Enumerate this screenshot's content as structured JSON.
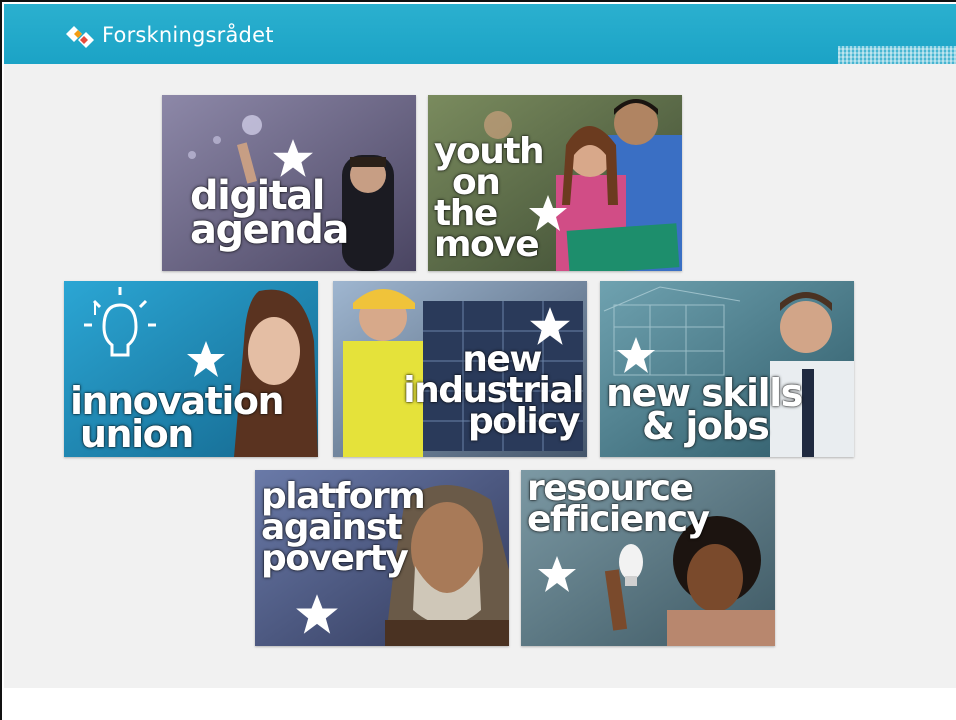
{
  "header": {
    "brand": "Forskningsrådet",
    "bar_color": "#1ba3c6"
  },
  "tiles": [
    {
      "id": "digital-agenda",
      "lines": [
        "digital",
        "agenda"
      ]
    },
    {
      "id": "youth-on-the-move",
      "lines": [
        "youth",
        "on",
        "the",
        "move"
      ]
    },
    {
      "id": "innovation-union",
      "lines": [
        "innovation",
        "union"
      ]
    },
    {
      "id": "new-industrial-policy",
      "lines": [
        "new",
        "industrial",
        "policy"
      ]
    },
    {
      "id": "new-skills-jobs",
      "lines": [
        "new skills",
        "& jobs"
      ]
    },
    {
      "id": "platform-against-poverty",
      "lines": [
        "platform",
        "against",
        "poverty"
      ]
    },
    {
      "id": "resource-efficiency",
      "lines": [
        "resource",
        "efficiency"
      ]
    }
  ],
  "icons": {
    "logo": "forskningsradet-logo-icon",
    "star": "star-icon"
  }
}
